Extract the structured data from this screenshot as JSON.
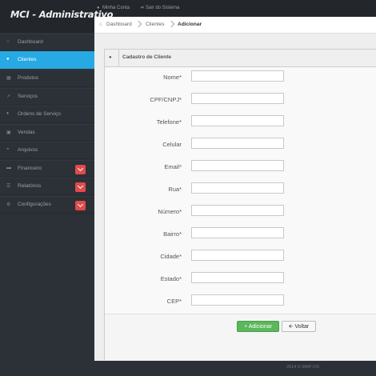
{
  "app": {
    "title": "MCI - Administrativo"
  },
  "topbar": {
    "items": [
      {
        "label": "Minha Conta",
        "icon": "user-icon"
      },
      {
        "label": "Sair do Sistema",
        "icon": "sign-out-icon"
      }
    ]
  },
  "sidebar": {
    "items": [
      {
        "label": "Dashboard",
        "icon": "home-icon",
        "active": false,
        "submenu": false
      },
      {
        "label": "Clientes",
        "icon": "group-icon",
        "active": true,
        "submenu": false
      },
      {
        "label": "Produtos",
        "icon": "barcode-icon",
        "active": false,
        "submenu": false
      },
      {
        "label": "Serviços",
        "icon": "wrench-icon",
        "active": false,
        "submenu": false
      },
      {
        "label": "Ordens de Serviço",
        "icon": "tags-icon",
        "active": false,
        "submenu": false
      },
      {
        "label": "Vendas",
        "icon": "cart-icon",
        "active": false,
        "submenu": false
      },
      {
        "label": "Arquivos",
        "icon": "hdd-icon",
        "active": false,
        "submenu": false
      },
      {
        "label": "Financeiro",
        "icon": "money-icon",
        "active": false,
        "submenu": true
      },
      {
        "label": "Relatórios",
        "icon": "list-icon",
        "active": false,
        "submenu": true
      },
      {
        "label": "Configurações",
        "icon": "cog-icon",
        "active": false,
        "submenu": true
      }
    ]
  },
  "breadcrumb": {
    "items": [
      "Dashboard",
      "Clientes",
      "Adicionar"
    ]
  },
  "form": {
    "title": "Cadastro de Cliente",
    "fields": [
      {
        "label": "Nome*",
        "value": ""
      },
      {
        "label": "CPF/CNPJ*",
        "value": ""
      },
      {
        "label": "Telefone*",
        "value": ""
      },
      {
        "label": "Celular",
        "value": ""
      },
      {
        "label": "Email*",
        "value": ""
      },
      {
        "label": "Rua*",
        "value": ""
      },
      {
        "label": "Número*",
        "value": ""
      },
      {
        "label": "Bairro*",
        "value": ""
      },
      {
        "label": "Cidade*",
        "value": ""
      },
      {
        "label": "Estado*",
        "value": ""
      },
      {
        "label": "CEP*",
        "value": ""
      }
    ],
    "add_label": "Adicionar",
    "back_label": "Voltar"
  },
  "footer": {
    "text": "2014 © MAP-OS"
  },
  "colors": {
    "accent": "#27a9e3",
    "success": "#5bb75b",
    "danger": "#e04b4b",
    "sidebar": "#2c3037"
  }
}
